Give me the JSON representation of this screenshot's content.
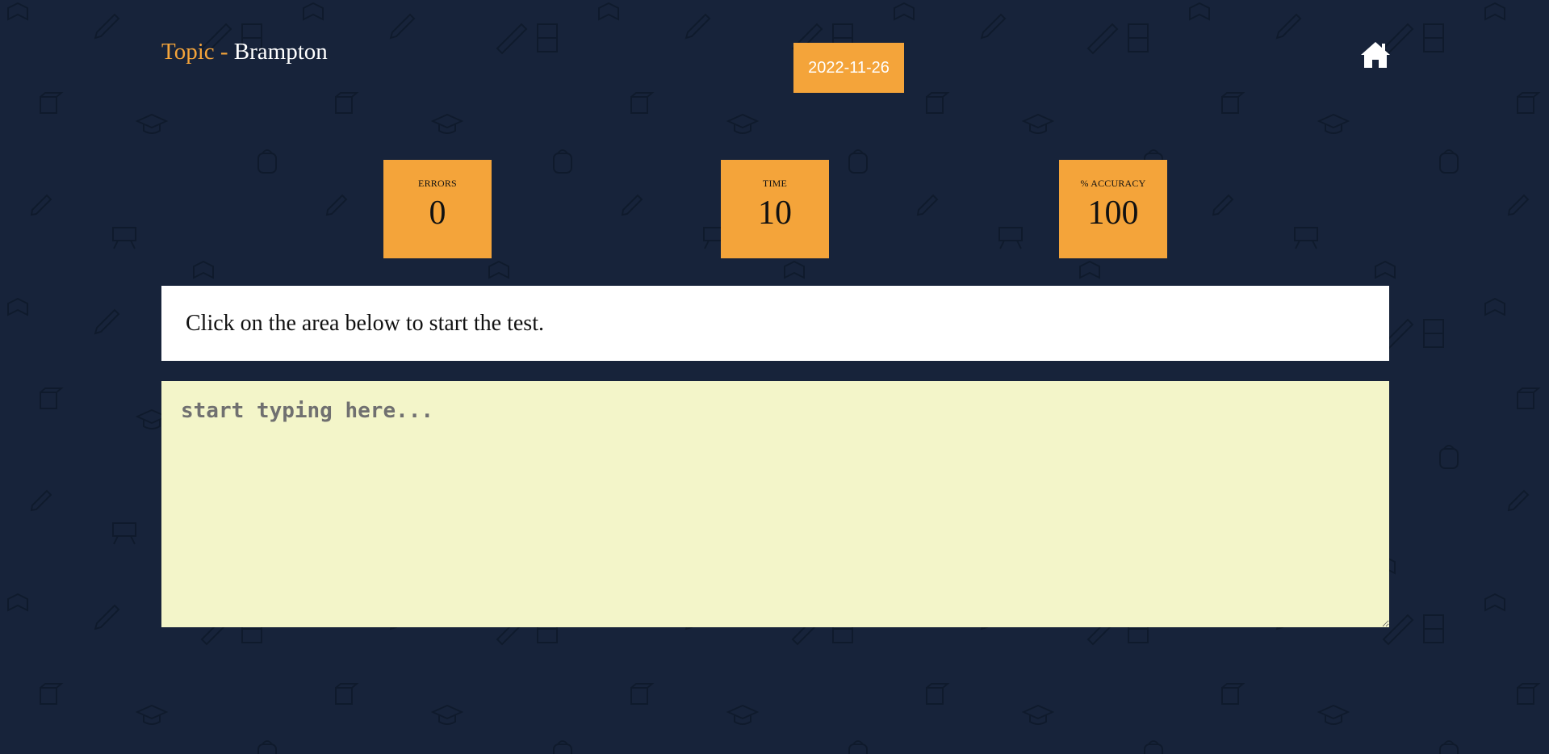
{
  "header": {
    "topic_label": "Topic",
    "topic_separator": " - ",
    "topic_name": "Brampton",
    "date": "2022-11-26",
    "home_icon": "home-icon"
  },
  "stats": {
    "errors": {
      "label": "ERRORS",
      "value": "0"
    },
    "time": {
      "label": "TIME",
      "value": "10"
    },
    "accuracy": {
      "label": "% ACCURACY",
      "value": "100"
    }
  },
  "instruction": {
    "text": "Click on the area below to start the test."
  },
  "typing": {
    "placeholder": "start typing here...",
    "value": ""
  },
  "colors": {
    "background": "#17233a",
    "accent": "#f4a43a",
    "typing_area": "#f3f5c9"
  }
}
